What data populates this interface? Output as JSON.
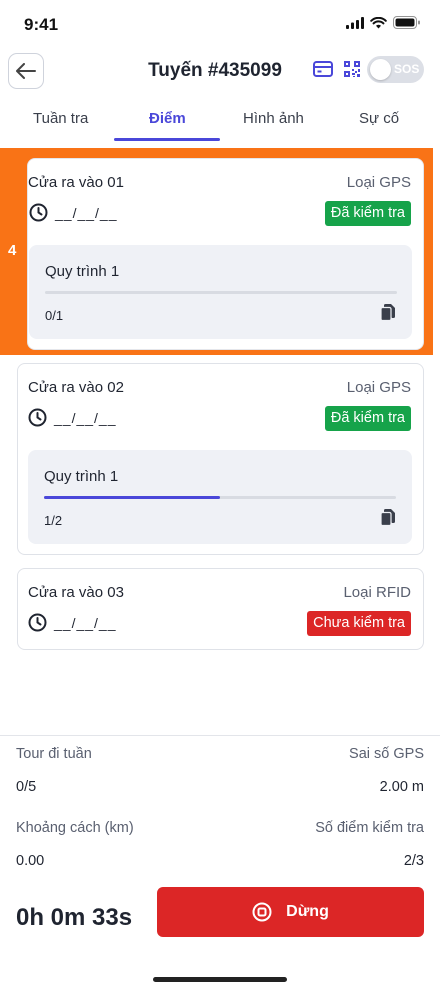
{
  "status_bar": {
    "time": "9:41"
  },
  "header": {
    "title": "Tuyến #435099",
    "sos_label": "SOS"
  },
  "tabs": [
    {
      "label": "Tuần tra"
    },
    {
      "label": "Điểm"
    },
    {
      "label": "Hình ảnh"
    },
    {
      "label": "Sự cố"
    }
  ],
  "highlight_number": "4",
  "points": [
    {
      "name": "Cửa ra vào 01",
      "type": "Loại GPS",
      "time": "__/__/__",
      "status": "Đã kiểm tra",
      "status_color": "#16a34a",
      "process": {
        "name": "Quy trình 1",
        "count": "0/1",
        "progress": 0
      }
    },
    {
      "name": "Cửa ra vào 02",
      "type": "Loại GPS",
      "time": "__/__/__",
      "status": "Đã kiểm tra",
      "status_color": "#16a34a",
      "process": {
        "name": "Quy trình 1",
        "count": "1/2",
        "progress": 0.5
      }
    },
    {
      "name": "Cửa ra vào 03",
      "type": "Loại RFID",
      "time": "__/__/__",
      "status": "Chưa kiểm tra",
      "status_color": "#dc2626"
    }
  ],
  "summary": {
    "tour_label": "Tour đi tuần",
    "tour_value": "0/5",
    "gps_error_label": "Sai số GPS",
    "gps_error_value": "2.00 m",
    "distance_label": "Khoảng cách (km)",
    "distance_value": "0.00",
    "checkpoints_label": "Số điểm kiểm tra",
    "checkpoints_value": "2/3",
    "timer": "0h 0m 33s",
    "stop_label": "Dừng"
  },
  "colors": {
    "accent": "#4a47d9",
    "highlight": "#f97316",
    "danger": "#dc2626",
    "success": "#16a34a"
  }
}
